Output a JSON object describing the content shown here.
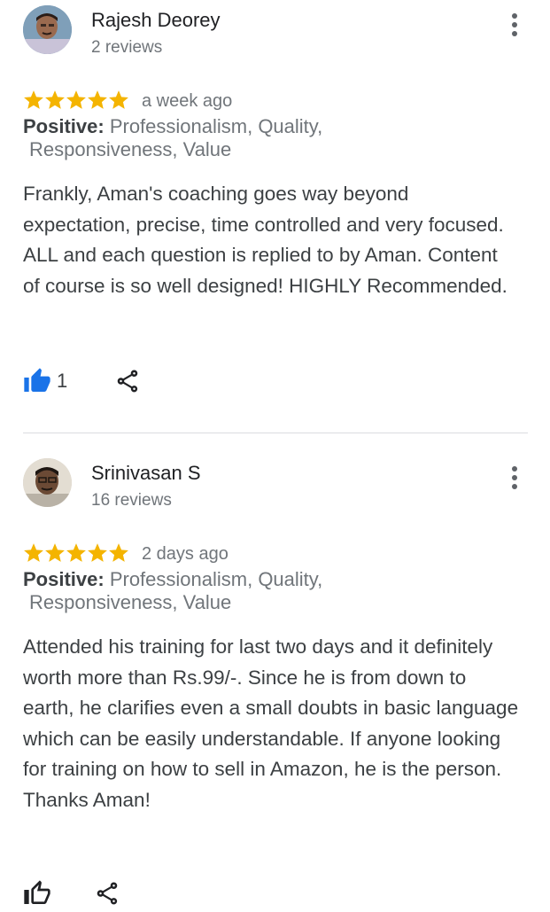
{
  "reviews": [
    {
      "name": "Rajesh Deorey",
      "review_count": "2 reviews",
      "rating": 5,
      "date": "a week ago",
      "positive_label": "Positive:",
      "positive_line1": " Professionalism, Quality,",
      "positive_line2": "Responsiveness, Value",
      "text": "Frankly, Aman's coaching goes way beyond expectation, precise, time controlled and very focused. ALL and each question is replied to by Aman. Content of course is so well designed! HIGHLY Recommended.",
      "likes": "1",
      "liked": true
    },
    {
      "name": "Srinivasan S",
      "review_count": "16 reviews",
      "rating": 5,
      "date": "2 days ago",
      "positive_label": "Positive:",
      "positive_line1": " Professionalism, Quality,",
      "positive_line2": "Responsiveness, Value",
      "text": "Attended his training for last two days and it definitely worth more than Rs.99/-. Since he is from down to earth, he clarifies even a small doubts in basic language which can be easily understandable. If anyone looking for training on how to sell in Amazon, he is the person. Thanks Aman!",
      "likes": "",
      "liked": false
    }
  ],
  "colors": {
    "star": "#f4b400",
    "like_active": "#1a73e8",
    "icon": "#3c4043"
  },
  "icons": {
    "star": "star-icon",
    "like": "thumbs-up-icon",
    "share": "share-icon",
    "more": "more-vertical-icon"
  }
}
